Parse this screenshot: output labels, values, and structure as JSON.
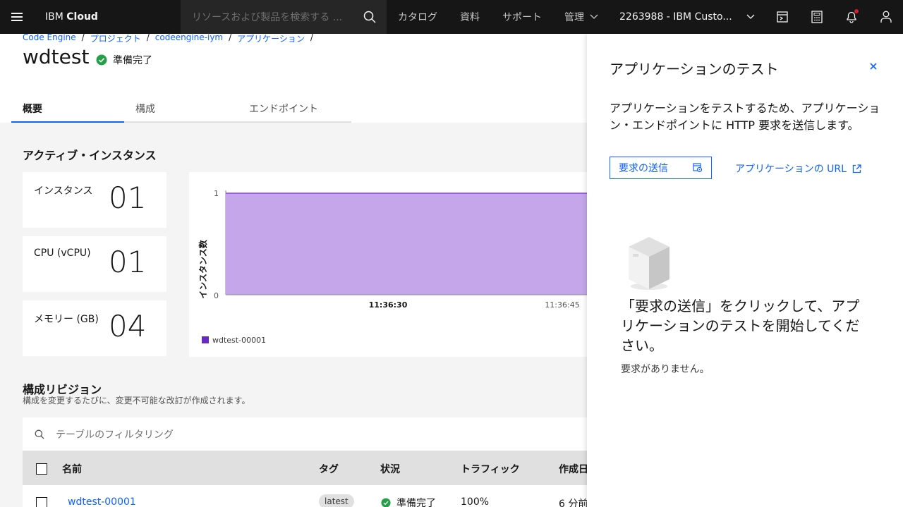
{
  "topnav": {
    "brand_prefix": "IBM",
    "brand_suffix": "Cloud",
    "search_placeholder": "リソースおよび製品を検索する ...",
    "links": [
      "カタログ",
      "資料",
      "サポート",
      "管理"
    ],
    "account": "2263988 - IBM Custo...",
    "icons": [
      "hamburger-menu-icon",
      "search-icon",
      "chevron-down-icon",
      "cost-estimator-icon",
      "calculator-icon",
      "notification-icon",
      "user-avatar-icon"
    ]
  },
  "breadcrumb": [
    "Code Engine",
    "プロジェクト",
    "codeengine-iym",
    "アプリケーション"
  ],
  "page": {
    "title": "wdtest",
    "status": "準備完了",
    "status_color": "#24a148"
  },
  "tabs": [
    "概要",
    "構成",
    "エンドポイント"
  ],
  "instances": {
    "heading": "アクティブ・インスタンス",
    "metrics": [
      {
        "label": "インスタンス",
        "value": "01"
      },
      {
        "label": "CPU (vCPU)",
        "value": "01"
      },
      {
        "label": "メモリー (GB)",
        "value": "04"
      }
    ]
  },
  "chart_data": {
    "type": "area",
    "ylabel": "インスタンス数",
    "yticks": [
      "1",
      "0"
    ],
    "ylim": [
      0,
      1
    ],
    "xticks": [
      "11:36:30",
      "11:36:45"
    ],
    "series": [
      {
        "name": "wdtest-00001",
        "values": [
          1,
          1,
          1
        ],
        "color": "#8a3ffc",
        "fill": "#c5a6ea"
      }
    ]
  },
  "revisions": {
    "heading": "構成リビジョン",
    "subtitle": "構成を変更するたびに、変更不可能な改訂が作成されます。",
    "filter_placeholder": "テーブルのフィルタリング",
    "columns": [
      "名前",
      "タグ",
      "状況",
      "トラフィック",
      "作成日"
    ],
    "rows": [
      {
        "name": "wdtest-00001",
        "tag": "latest",
        "status": "準備完了",
        "traffic": "100%",
        "created": "6 分前"
      }
    ]
  },
  "panel": {
    "title": "アプリケーションのテスト",
    "description": "アプリケーションをテストするため、アプリケーション・エンドポイントに HTTP 要求を送信します。",
    "send_button": "要求の送信",
    "url_link": "アプリケーションの URL",
    "empty_title": "「要求の送信」をクリックして、アプリケーションのテストを開始してください。",
    "empty_subtitle": "要求がありません。"
  }
}
